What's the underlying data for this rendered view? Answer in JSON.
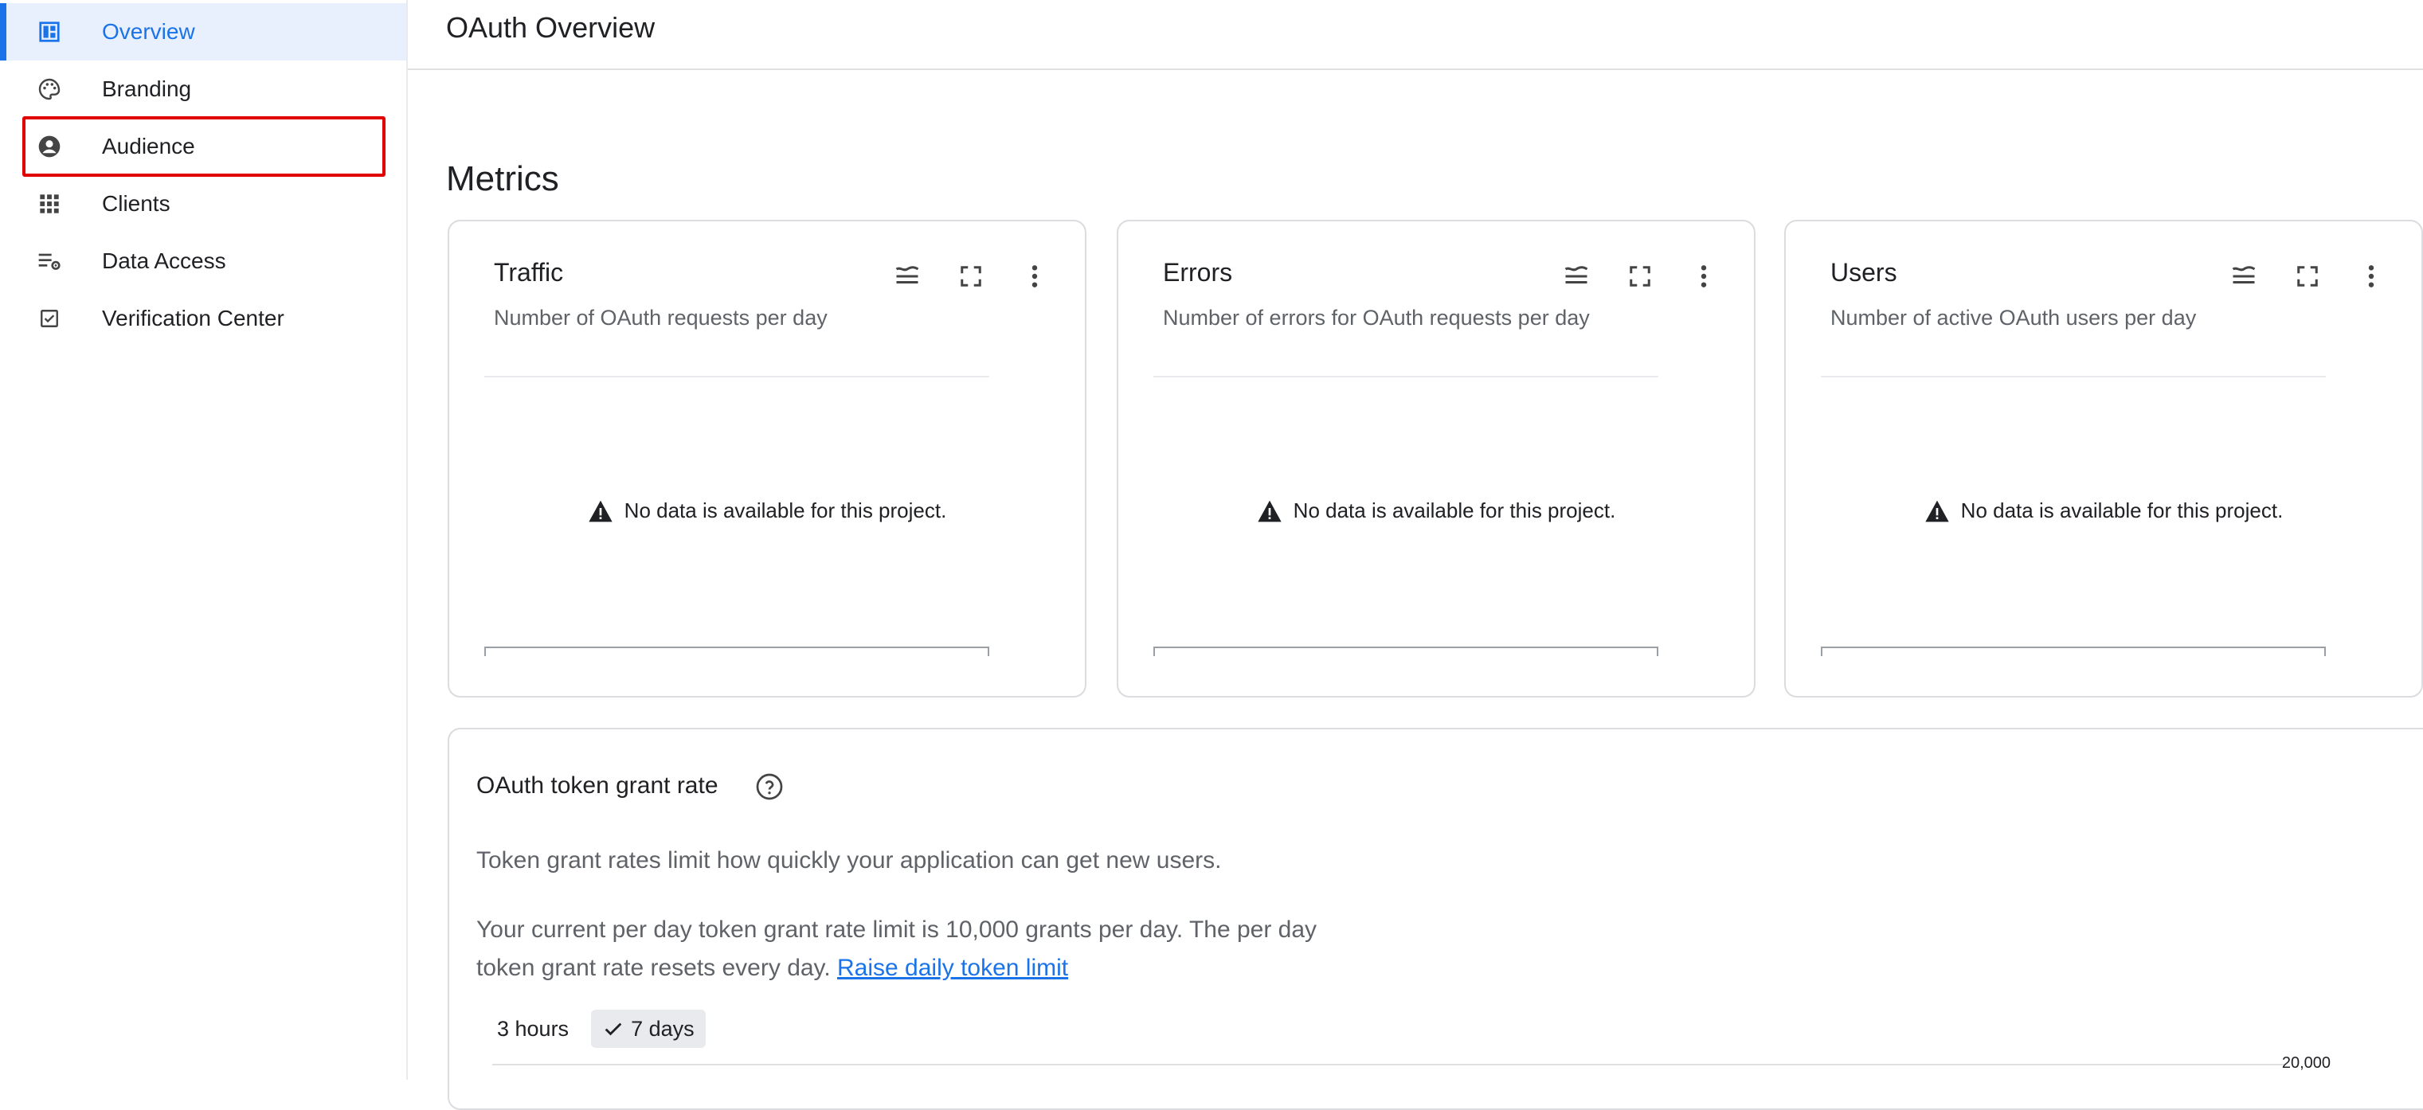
{
  "sidebar": {
    "items": [
      {
        "label": "Overview",
        "icon": "dashboard-icon",
        "active": true
      },
      {
        "label": "Branding",
        "icon": "palette-icon"
      },
      {
        "label": "Audience",
        "icon": "account-circle-icon"
      },
      {
        "label": "Clients",
        "icon": "apps-grid-icon"
      },
      {
        "label": "Data Access",
        "icon": "list-settings-icon"
      },
      {
        "label": "Verification Center",
        "icon": "checkbox-icon"
      }
    ]
  },
  "header": {
    "title": "OAuth Overview"
  },
  "metrics": {
    "title": "Metrics",
    "cards": [
      {
        "title": "Traffic",
        "subtitle": "Number of OAuth requests per day",
        "empty_message": "No data is available for this project."
      },
      {
        "title": "Errors",
        "subtitle": "Number of errors for OAuth requests per day",
        "empty_message": "No data is available for this project."
      },
      {
        "title": "Users",
        "subtitle": "Number of active OAuth users per day",
        "empty_message": "No data is available for this project."
      }
    ]
  },
  "grant": {
    "title": "OAuth token grant rate",
    "description": "Token grant rates limit how quickly your application can get new users.",
    "limit_text": "Your current per day token grant rate limit is 10,000 grants per day. The per day token grant rate resets every day.",
    "link_label": "Raise daily token limit",
    "ranges": [
      {
        "label": "3 hours",
        "selected": false
      },
      {
        "label": "7 days",
        "selected": true
      }
    ],
    "y_tick": "20,000"
  },
  "colors": {
    "accent": "#1a73e8",
    "active_bg": "#e8f0fe",
    "highlight": "#e00000"
  }
}
